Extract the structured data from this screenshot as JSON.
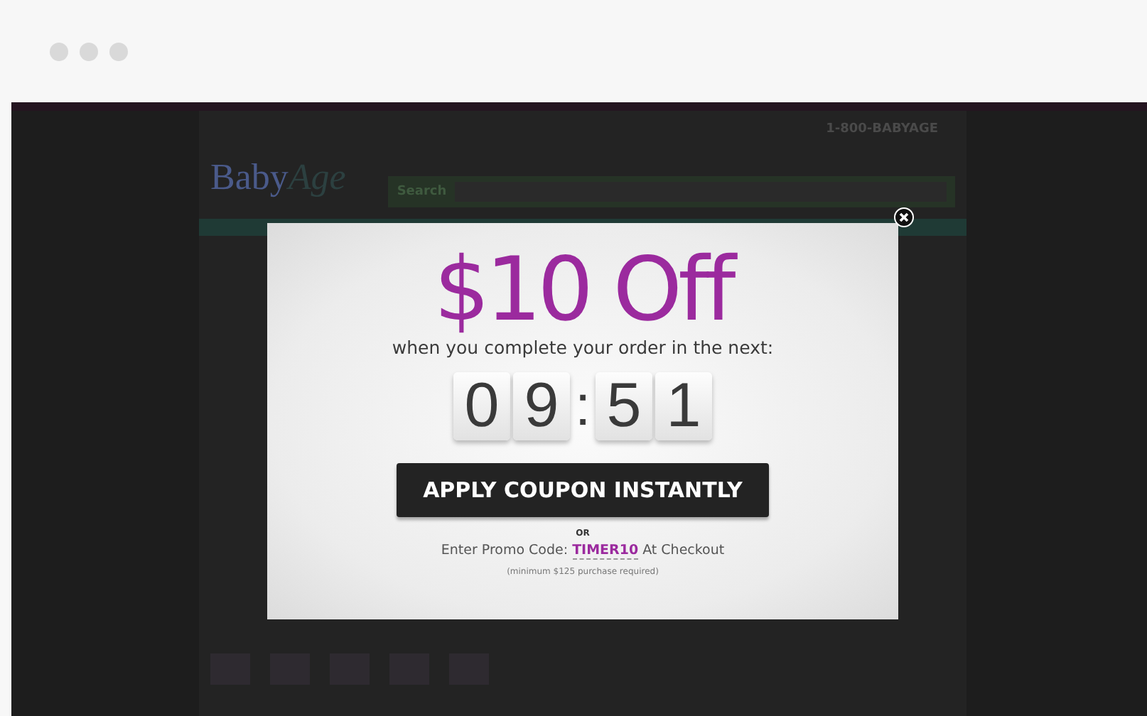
{
  "site": {
    "phone": "1-800-BABYAGE",
    "logo": [
      "Baby",
      "Age"
    ],
    "search_label": "Search"
  },
  "popup": {
    "headline": "$10 Off",
    "subtitle": "when you complete your order in the next:",
    "timer": [
      {
        "kind": "digit",
        "text": "0"
      },
      {
        "kind": "digit",
        "text": "9"
      },
      {
        "kind": "separator",
        "text": ":"
      },
      {
        "kind": "digit",
        "text": "5"
      },
      {
        "kind": "digit",
        "text": "1"
      }
    ],
    "button": "APPLY COUPON INSTANTLY",
    "or": "OR",
    "promo": "Enter Promo Code: **TIMER10** At Checkout",
    "note": "(minimum $125 purchase required)"
  }
}
